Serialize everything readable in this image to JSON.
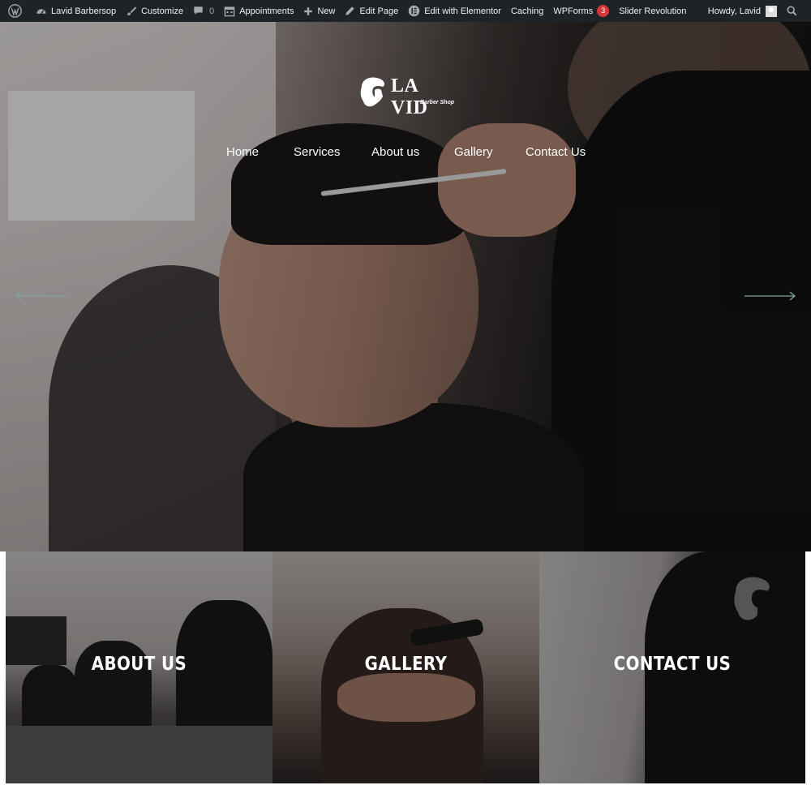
{
  "admin_bar": {
    "site_name": "Lavid Barbersop",
    "customize": "Customize",
    "comments_count": "0",
    "appointments": "Appointments",
    "new": "New",
    "edit_page": "Edit Page",
    "edit_with_elementor": "Edit with Elementor",
    "caching": "Caching",
    "wpforms": "WPForms",
    "wpforms_count": "3",
    "slider_revolution": "Slider Revolution",
    "howdy": "Howdy, Lavid"
  },
  "logo": {
    "name": "LA VID",
    "tagline": "Barber Shop"
  },
  "nav": [
    "Home",
    "Services",
    "About us",
    "Gallery",
    "Contact Us"
  ],
  "tiles": [
    "ABOUT US",
    "GALLERY",
    "CONTACT US"
  ],
  "colors": {
    "admin_bar_bg": "#1d2327",
    "badge": "#d63638",
    "arrow": "#7fa898"
  },
  "icons": {
    "admin_bar": [
      "wordpress-icon",
      "dashboard-icon",
      "brush-icon",
      "comment-icon",
      "calendar-icon",
      "plus-icon",
      "pencil-icon",
      "elementor-icon",
      "avatar-icon",
      "search-icon"
    ],
    "hero": [
      "prev-arrow-icon",
      "next-arrow-icon"
    ]
  }
}
